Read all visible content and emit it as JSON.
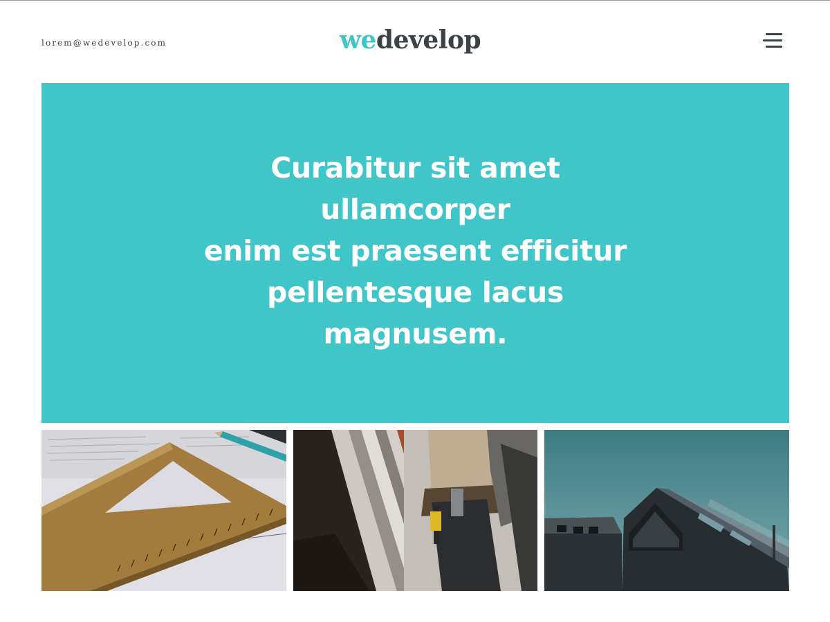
{
  "header": {
    "email": "lorem@wedevelop.com",
    "logo": {
      "part1": "we",
      "part2": "develop"
    },
    "menu_icon": "hamburger-menu-icon"
  },
  "hero": {
    "line1": "Curabitur sit amet ullamcorper",
    "line2": "enim est praesent efficitur",
    "line3": "pellentesque lacus magnusem."
  },
  "gallery": {
    "items": [
      {
        "subject": "wooden set square ruler with pencil on paper"
      },
      {
        "subject": "construction worker with tool belt beside timber cladding"
      },
      {
        "subject": "dark timber-clad houses under teal sky"
      }
    ]
  },
  "colors": {
    "accent": "#40c5c9",
    "logo_accent": "#3ec5c8",
    "logo_dark": "#3a4245",
    "text_dark": "#3d4446",
    "background": "#ffffff"
  }
}
